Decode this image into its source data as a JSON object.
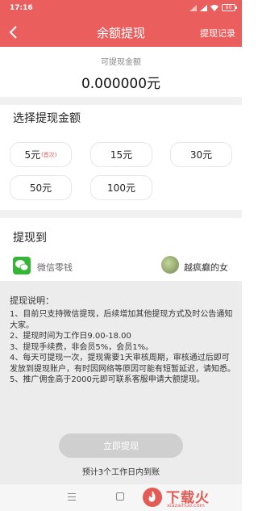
{
  "status_bar": {
    "time": "17:16",
    "battery": "60"
  },
  "header": {
    "title": "余额提现",
    "record_link": "提现记录"
  },
  "balance": {
    "label": "可提现金额",
    "value": "0.000000元"
  },
  "choose": {
    "title": "选择提现金额",
    "options": [
      {
        "label": "5元",
        "badge": "(首次)"
      },
      {
        "label": "15元"
      },
      {
        "label": "30元"
      },
      {
        "label": "50元"
      },
      {
        "label": "100元"
      }
    ]
  },
  "withdraw_to": {
    "title": "提现到",
    "method": "微信零钱",
    "nickname": "越疯癫的女"
  },
  "instructions": {
    "title": "提现说明：",
    "lines": [
      "1、目前只支持微信提现，后续增加其他提现方式及时公告通知大家。",
      "2、提现时间为工作日9.00-18.00",
      "3、提现手续费，非会员5%，会员1%。",
      "4、每天可提现一次，提现需要1天审核周期，审核通过后即可发放到提现账户，有时因网络等原因可能有短暂延迟，请知悉。",
      "5、推广佣金高于2000元即可联系客服申请大额提现。"
    ]
  },
  "action": {
    "button_label": "立即提现",
    "note": "预计3个工作日内到账"
  },
  "watermark": {
    "text": "下载火",
    "url": "xiazaihuo.com"
  },
  "colors": {
    "accent": "#ea5f5e",
    "wechat_green": "#35b535",
    "button_disabled": "#cfcfcf"
  }
}
